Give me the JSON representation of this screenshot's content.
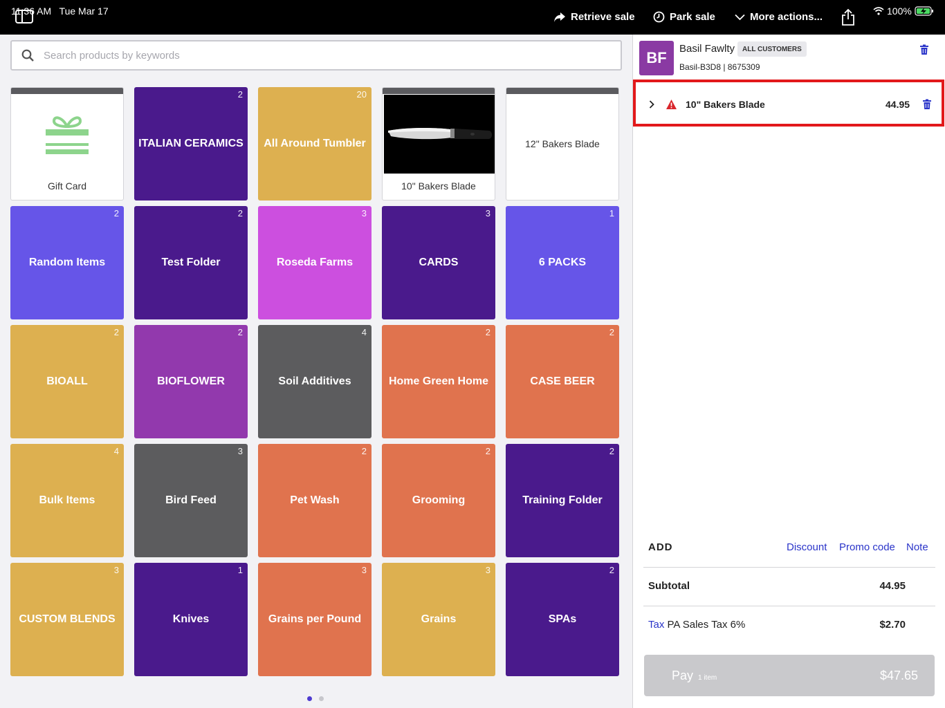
{
  "status_bar": {
    "time": "11:36 AM",
    "date": "Tue Mar 17",
    "battery": "100%"
  },
  "toolbar": {
    "retrieve_sale": "Retrieve sale",
    "park_sale": "Park sale",
    "more_actions": "More actions..."
  },
  "search": {
    "placeholder": "Search products by keywords",
    "value": ""
  },
  "tiles": [
    {
      "label": "Gift Card",
      "count": "",
      "color": "#ffffff",
      "kind": "gift"
    },
    {
      "label": "ITALIAN CERAMICS",
      "count": "2",
      "color": "#4a1a8c"
    },
    {
      "label": "All Around Tumbler",
      "count": "20",
      "color": "#ddb050"
    },
    {
      "label": "10\" Bakers Blade",
      "count": "",
      "color": "#ffffff",
      "kind": "image"
    },
    {
      "label": "12\" Bakers Blade",
      "count": "",
      "color": "#ffffff",
      "kind": "plain"
    },
    {
      "label": "Random Items",
      "count": "2",
      "color": "#6655e8"
    },
    {
      "label": "Test Folder",
      "count": "2",
      "color": "#4a1a8c"
    },
    {
      "label": "Roseda Farms",
      "count": "3",
      "color": "#cc4fdf"
    },
    {
      "label": "CARDS",
      "count": "3",
      "color": "#4a1a8c"
    },
    {
      "label": "6 PACKS",
      "count": "1",
      "color": "#6655e8"
    },
    {
      "label": "BIOALL",
      "count": "2",
      "color": "#ddb050"
    },
    {
      "label": "BIOFLOWER",
      "count": "2",
      "color": "#9239ad"
    },
    {
      "label": "Soil Additives",
      "count": "4",
      "color": "#5c5c5e"
    },
    {
      "label": "Home Green Home",
      "count": "2",
      "color": "#e0734e"
    },
    {
      "label": "CASE BEER",
      "count": "2",
      "color": "#e0734e"
    },
    {
      "label": "Bulk Items",
      "count": "4",
      "color": "#ddb050"
    },
    {
      "label": "Bird Feed",
      "count": "3",
      "color": "#5c5c5e"
    },
    {
      "label": "Pet Wash",
      "count": "2",
      "color": "#e0734e"
    },
    {
      "label": "Grooming",
      "count": "2",
      "color": "#e0734e"
    },
    {
      "label": "Training Folder",
      "count": "2",
      "color": "#4a1a8c"
    },
    {
      "label": "CUSTOM BLENDS",
      "count": "3",
      "color": "#ddb050"
    },
    {
      "label": "Knives",
      "count": "1",
      "color": "#4a1a8c"
    },
    {
      "label": "Grains per Pound",
      "count": "3",
      "color": "#e0734e"
    },
    {
      "label": "Grains",
      "count": "3",
      "color": "#ddb050"
    },
    {
      "label": "SPAs",
      "count": "2",
      "color": "#4a1a8c"
    }
  ],
  "customer": {
    "initials": "BF",
    "name": "Basil Fawlty",
    "group": "ALL CUSTOMERS",
    "code": "Basil-B3D8 | 8675309"
  },
  "line_items": [
    {
      "name": "10\" Bakers Blade",
      "price": "44.95"
    }
  ],
  "add_section": {
    "label": "ADD",
    "discount": "Discount",
    "promo_code": "Promo code",
    "note": "Note"
  },
  "summary": {
    "subtotal_label": "Subtotal",
    "subtotal_value": "44.95",
    "tax_link": "Tax",
    "tax_name": "PA Sales Tax 6%",
    "tax_value": "$2.70"
  },
  "pay": {
    "label": "Pay",
    "items": "1 item",
    "total": "$47.65"
  },
  "colors": {
    "accent": "#2a34c9",
    "highlight": "#e2191b",
    "warning": "#d9262c"
  }
}
